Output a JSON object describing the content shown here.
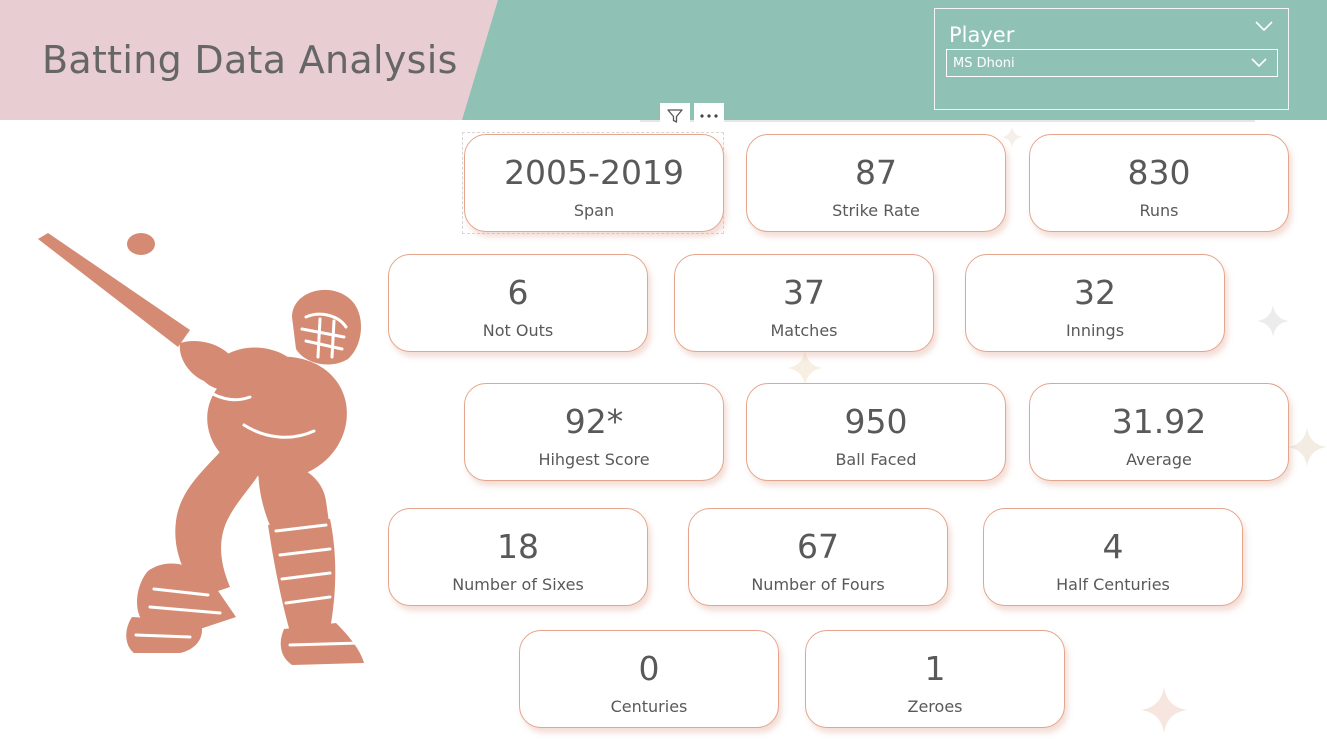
{
  "header": {
    "title": "Batting Data Analysis"
  },
  "slicer": {
    "header": "Player",
    "selected_value": "MS Dhoni",
    "chevron_icon": "chevron-down-icon"
  },
  "visual_tools": {
    "filter_icon": "filter-icon",
    "more_icon": "more-options-icon"
  },
  "colors": {
    "title_band": "#e8cdd2",
    "teal_band": "#8fc2b5",
    "card_border": "#e4a58c",
    "illustration": "#d58b73",
    "text": "#595959"
  },
  "illustration": {
    "icon": "cricket-batsman-icon"
  },
  "cards": [
    {
      "value": "2005-2019",
      "label": "Span"
    },
    {
      "value": "87",
      "label": "Strike Rate"
    },
    {
      "value": "830",
      "label": "Runs"
    },
    {
      "value": "6",
      "label": "Not Outs"
    },
    {
      "value": "37",
      "label": "Matches"
    },
    {
      "value": "32",
      "label": "Innings"
    },
    {
      "value": "92*",
      "label": "Hihgest Score"
    },
    {
      "value": "950",
      "label": "Ball Faced"
    },
    {
      "value": "31.92",
      "label": "Average"
    },
    {
      "value": "18",
      "label": "Number of Sixes"
    },
    {
      "value": "67",
      "label": "Number of Fours"
    },
    {
      "value": "4",
      "label": "Half Centuries"
    },
    {
      "value": "0",
      "label": "Centuries"
    },
    {
      "value": "1",
      "label": "Zeroes"
    }
  ]
}
